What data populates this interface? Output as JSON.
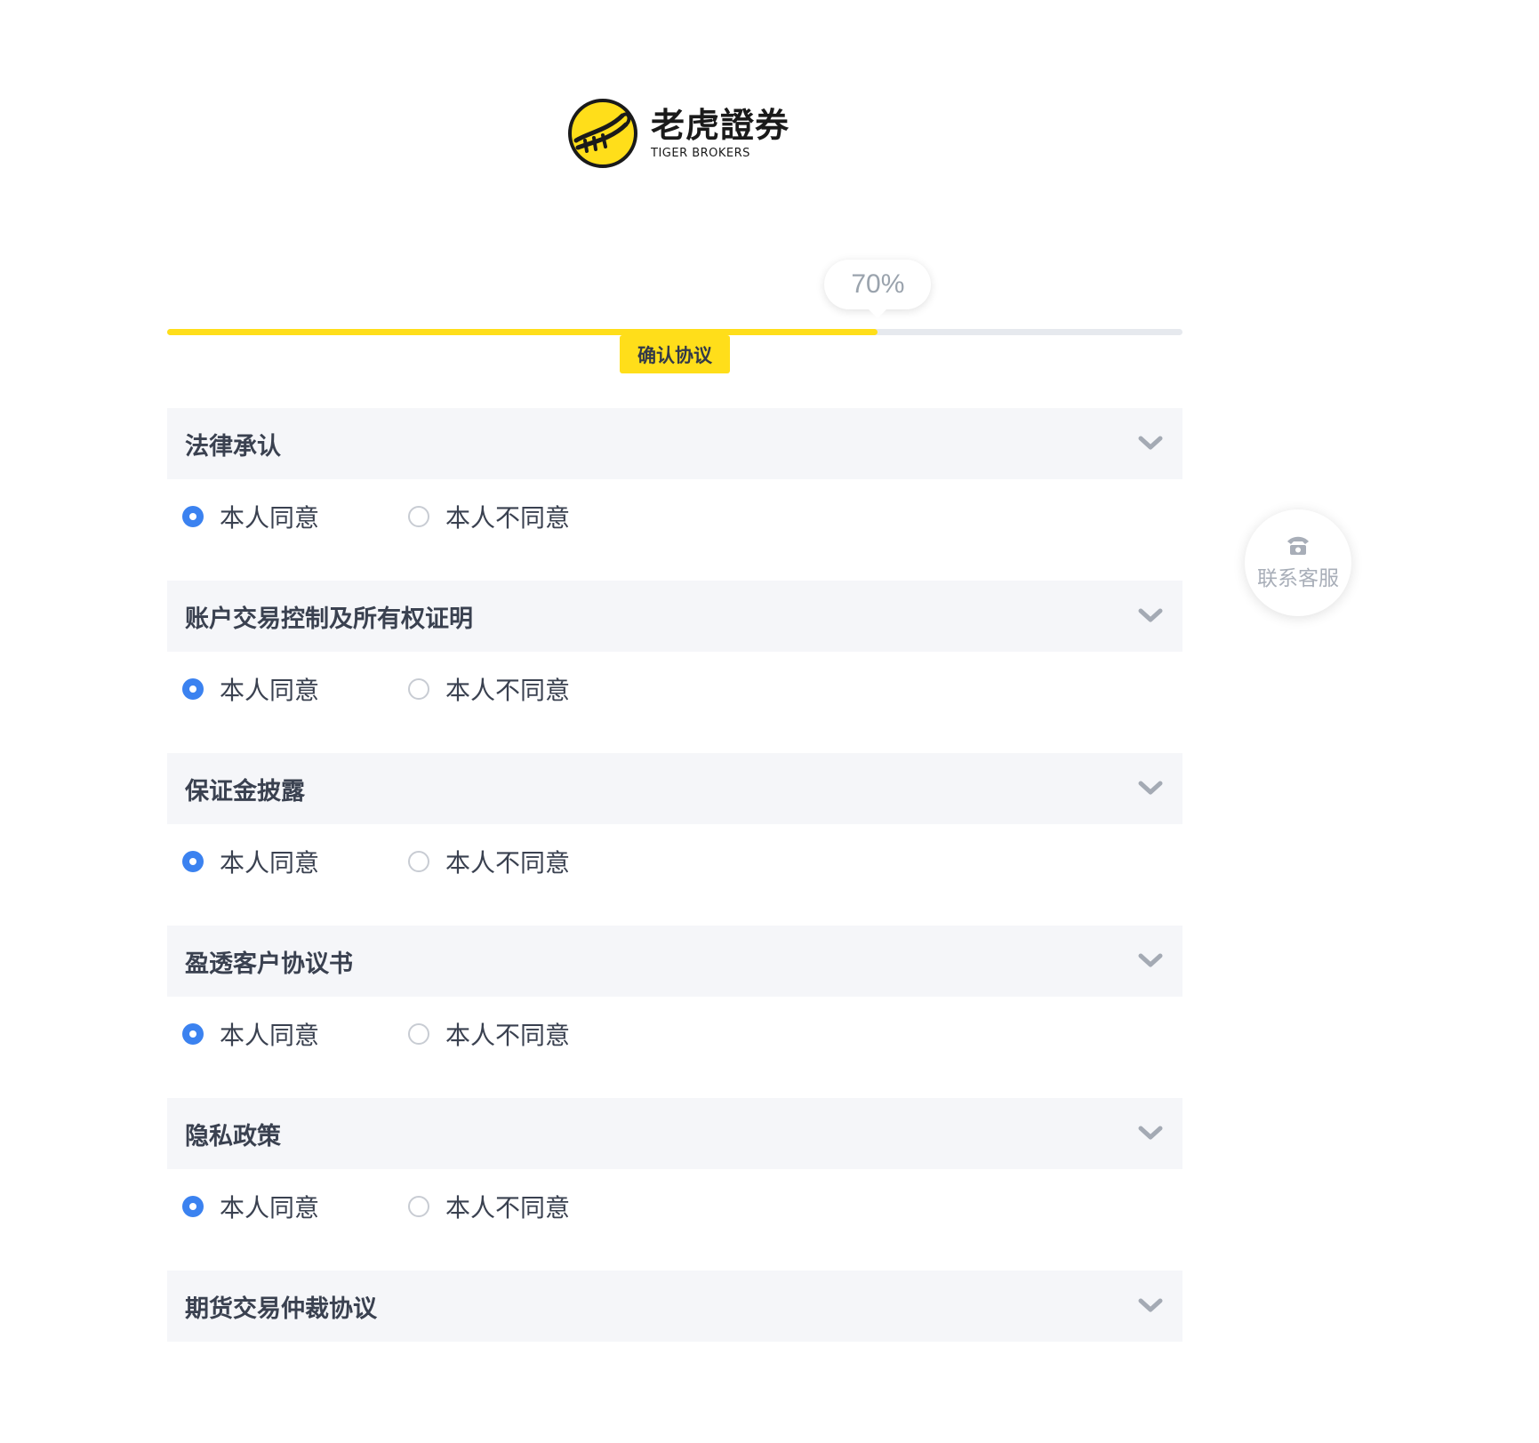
{
  "brand": {
    "name_cn": "老虎證券",
    "name_en": "TIGER BROKERS",
    "accent_color": "#ffde1a"
  },
  "progress": {
    "percent": 70,
    "percent_label": "70%",
    "step_label": "确认协议"
  },
  "radio_colors": {
    "checked": "#3b82f0",
    "unchecked_border": "#c8ccd3"
  },
  "sections": [
    {
      "title": "法律承认",
      "options": [
        {
          "label": "本人同意",
          "checked": true
        },
        {
          "label": "本人不同意",
          "checked": false
        }
      ]
    },
    {
      "title": "账户交易控制及所有权证明",
      "options": [
        {
          "label": "本人同意",
          "checked": true
        },
        {
          "label": "本人不同意",
          "checked": false
        }
      ]
    },
    {
      "title": "保证金披露",
      "options": [
        {
          "label": "本人同意",
          "checked": true
        },
        {
          "label": "本人不同意",
          "checked": false
        }
      ]
    },
    {
      "title": "盈透客户协议书",
      "options": [
        {
          "label": "本人同意",
          "checked": true
        },
        {
          "label": "本人不同意",
          "checked": false
        }
      ]
    },
    {
      "title": "隐私政策",
      "options": [
        {
          "label": "本人同意",
          "checked": true
        },
        {
          "label": "本人不同意",
          "checked": false
        }
      ]
    },
    {
      "title": "期货交易仲裁协议",
      "options": []
    }
  ],
  "service": {
    "label": "联系客服",
    "icon": "telephone-icon"
  }
}
